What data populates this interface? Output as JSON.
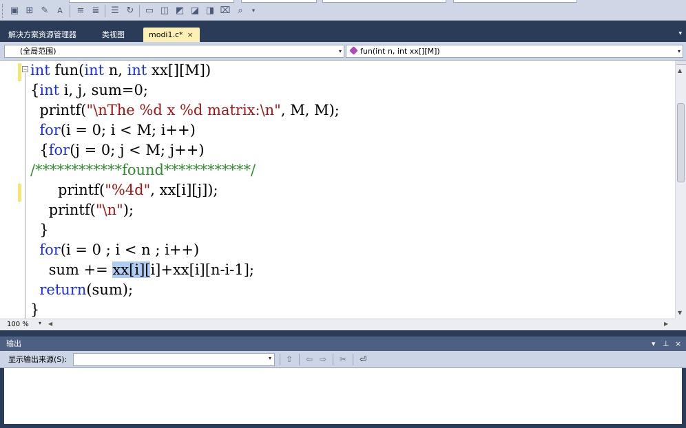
{
  "window": {
    "tabs": [
      {
        "label": "解决方案资源管理器",
        "active": false
      },
      {
        "label": "类视图",
        "active": false
      },
      {
        "label": "modi1.c*",
        "active": true
      }
    ],
    "close_glyph": "×",
    "tab_menu_glyph": "▾"
  },
  "toolbar": {
    "icons": [
      "properties-icon",
      "class-view-icon",
      "find-symbol-icon",
      "font-size-icon",
      "indent-icon",
      "outdent-icon",
      "comment-icon",
      "uncomment-icon",
      "bookmark-icon",
      "prev-bookmark-icon",
      "next-bookmark-icon",
      "prev-bookmark-folder-icon",
      "next-bookmark-folder-icon",
      "clear-bookmarks-icon",
      "find-in-files-icon"
    ],
    "glyphs": [
      "▣",
      "⊞",
      "✎",
      "A",
      "≡",
      "≣",
      "☰",
      "↻",
      "▭",
      "◫",
      "◩",
      "◪",
      "◨",
      "⌧",
      "⌕"
    ],
    "more_glyph": "▾"
  },
  "navbar": {
    "scope": "(全局范围)",
    "member": "fun(int n, int xx[][M])",
    "dropdown_glyph": "▾"
  },
  "editor": {
    "lines": [
      {
        "text": "int fun(int n, int xx[][M])"
      },
      {
        "text": "{int i, j, sum=0;"
      },
      {
        "text": "  printf(\"\\nThe %d x %d matrix:\\n\", M, M);"
      },
      {
        "text": "  for(i = 0; i < M; i++)"
      },
      {
        "text": "  {for(j = 0; j < M; j++)"
      },
      {
        "text": "/************found************/"
      },
      {
        "text": "      printf(\"%4d\", xx[i][j]);"
      },
      {
        "text": "    printf(\"\\n\");"
      },
      {
        "text": "  }"
      },
      {
        "text": "  for(i = 0 ; i < n ; i++)"
      },
      {
        "text": "    sum += xx[i][i]+xx[i][n-i-1];"
      },
      {
        "text": "  return(sum);"
      },
      {
        "text": "}"
      }
    ],
    "selected_text": "xx[i][",
    "outline_glyph": "−"
  },
  "statusbar": {
    "zoom": "100 %",
    "zoom_dd": "▾"
  },
  "output": {
    "title": "输出",
    "pin_glyph": "▾ ⊥ ×",
    "source_label": "显示输出来源(S):",
    "source_value": "",
    "buttons": [
      "go-to-line-icon",
      "prev-message-icon",
      "next-message-icon",
      "clear-all-icon",
      "word-wrap-icon"
    ],
    "button_glyphs": [
      "⇧",
      "⇦",
      "⇨",
      "✂",
      "⏎"
    ]
  },
  "colors": {
    "keyword": "#1b30e6",
    "string": "#a31515",
    "comment": "#2e8b2e",
    "selection": "#aecbf0",
    "chrome": "#2b3c59"
  }
}
